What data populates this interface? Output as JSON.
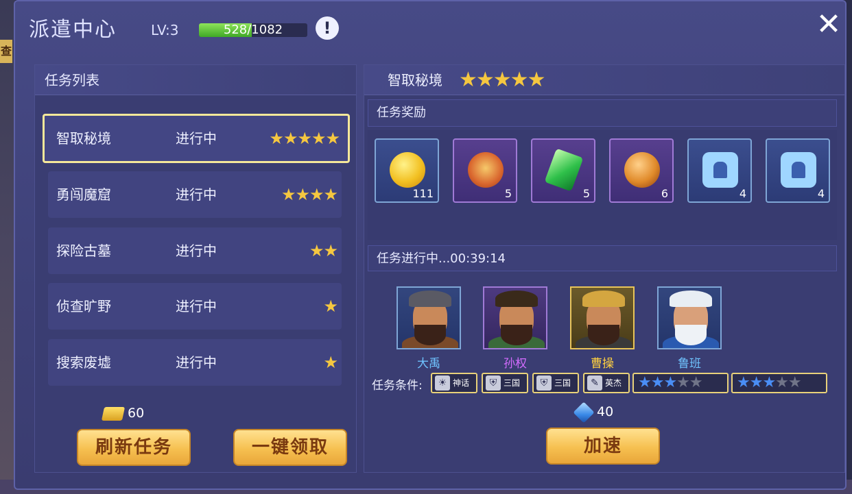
{
  "window": {
    "title": "派遣中心",
    "level": "LV:3",
    "xp_text": "528/1082",
    "xp_fraction": 0.488,
    "info_icon": "!",
    "close_icon": "✕"
  },
  "left": {
    "header": "任务列表",
    "tasks": [
      {
        "name": "智取秘境",
        "status": "进行中",
        "stars": "★★★★★"
      },
      {
        "name": "勇闯魔窟",
        "status": "进行中",
        "stars": "★★★★"
      },
      {
        "name": "探险古墓",
        "status": "进行中",
        "stars": "★★"
      },
      {
        "name": "侦查旷野",
        "status": "进行中",
        "stars": "★"
      },
      {
        "name": "搜索废墟",
        "status": "进行中",
        "stars": "★"
      }
    ],
    "gold_cost": "60",
    "refresh_label": "刷新任务",
    "claim_label": "一键领取"
  },
  "right": {
    "task_title": "智取秘境",
    "task_stars": "★★★★★",
    "reward_header": "任务奖励",
    "rewards": [
      {
        "icon": "gold-coin-icon",
        "count": "111"
      },
      {
        "icon": "medal-icon",
        "count": "5"
      },
      {
        "icon": "green-gem-icon",
        "count": "5"
      },
      {
        "icon": "fire-orb-icon",
        "count": "6"
      },
      {
        "icon": "helmet-puzzle-icon",
        "count": "4"
      },
      {
        "icon": "helmet-puzzle-icon",
        "count": "4"
      }
    ],
    "progress_text": "任务进行中...00:39:14",
    "heroes": [
      {
        "name": "大禹",
        "color": "#6fc3ff"
      },
      {
        "name": "孙权",
        "color": "#d46cff"
      },
      {
        "name": "曹操",
        "color": "#ffd040"
      },
      {
        "name": "鲁班",
        "color": "#6fc3ff"
      }
    ],
    "condition_label": "任务条件:",
    "conditions": [
      {
        "icon": "sun-icon",
        "glyph": "☀",
        "text": "神话"
      },
      {
        "icon": "shield-icon",
        "glyph": "⛨",
        "text": "三国"
      },
      {
        "icon": "shield-icon",
        "glyph": "⛨",
        "text": "三国"
      },
      {
        "icon": "scroll-icon",
        "glyph": "✎",
        "text": "英杰"
      }
    ],
    "star_conditions": [
      {
        "filled": "★★★",
        "empty": "★★"
      },
      {
        "filled": "★★★",
        "empty": "★★"
      }
    ],
    "diamond_cost": "40",
    "speed_label": "加速"
  }
}
